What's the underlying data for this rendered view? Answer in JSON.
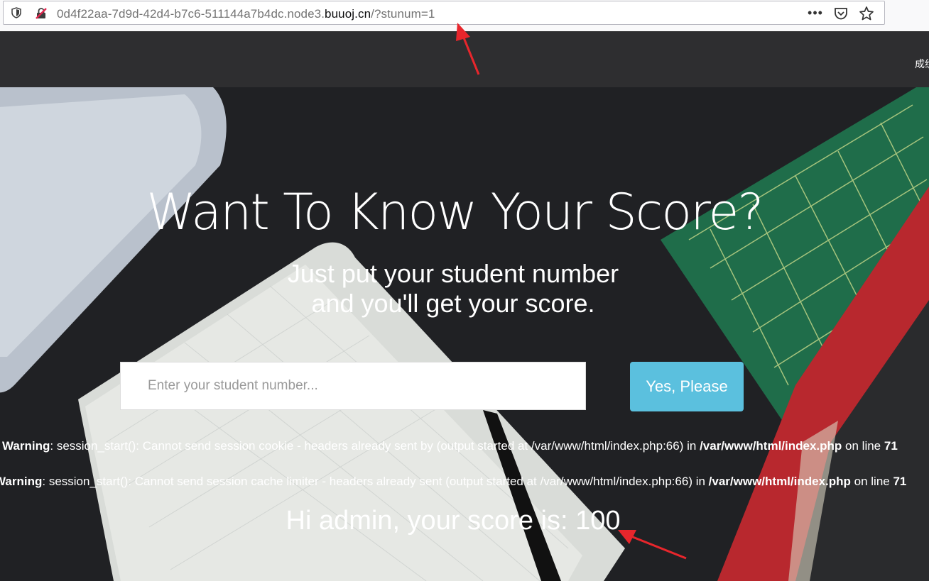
{
  "browser": {
    "url_prefix": "0d4f22aa-7d9d-42d4-b7c6-511144a7b4dc.node3.",
    "url_domain": "buuoj.cn",
    "url_suffix": "/?stunum=1",
    "more_label": "•••"
  },
  "nav": {
    "link_label": "成绩"
  },
  "hero": {
    "headline": "Want To Know Your Score?",
    "subline_1": "Just put your student number",
    "subline_2": "and you'll get your score.",
    "search_placeholder": "Enter your student number...",
    "button_label": "Yes, Please"
  },
  "warnings": [
    {
      "label": "Warning",
      "message": ": session_start(): Cannot send session cookie - headers already sent by (output started at /var/www/html/index.php:66) in ",
      "file": "/var/www/html/index.php",
      "on_line": " on line ",
      "line": "71"
    },
    {
      "label": "Warning",
      "message": ": session_start(): Cannot send session cache limiter - headers already sent (output started at /var/www/html/index.php:66) in ",
      "file": "/var/www/html/index.php",
      "on_line": " on line ",
      "line": "71"
    }
  ],
  "result": {
    "text": "Hi admin, your score is: 100"
  },
  "colors": {
    "button": "#5bc0de",
    "navbar": "#2e2e30",
    "annotation_arrow": "#e8262c"
  }
}
